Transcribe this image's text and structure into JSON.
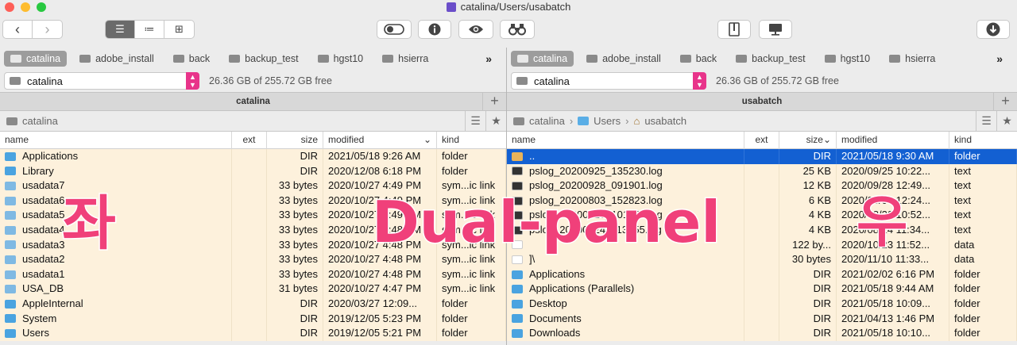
{
  "window": {
    "title": "catalina/Users/usabatch"
  },
  "toolbar": {
    "back": "‹",
    "forward": "›",
    "view_list": "☰",
    "view_detail": "≔",
    "view_grid": "⊞",
    "toggle_icon": "toggle-icon",
    "info_icon": "i",
    "eye_icon": "eye-icon",
    "binoculars_icon": "binoculars-icon",
    "archive_icon": "archive-icon",
    "network_icon": "network-icon",
    "download_icon": "↓"
  },
  "tabs": [
    "catalina",
    "adobe_install",
    "back",
    "backup_test",
    "hgst10",
    "hsierra"
  ],
  "tabs_more": "»",
  "left": {
    "volume": "catalina",
    "free": "26.36 GB of 255.72 GB free",
    "path_title": "catalina",
    "crumbs": [
      "catalina"
    ],
    "columns": {
      "name": "name",
      "ext": "ext",
      "size": "size",
      "modified": "modified",
      "kind": "kind"
    },
    "rows": [
      {
        "name": "Applications",
        "ext": "",
        "size": "DIR",
        "modified": "2021/05/18 9:26 AM",
        "kind": "folder",
        "icon": "folder"
      },
      {
        "name": "Library",
        "ext": "",
        "size": "DIR",
        "modified": "2020/12/08 6:18 PM",
        "kind": "folder",
        "icon": "folder"
      },
      {
        "name": "usadata7",
        "ext": "",
        "size": "33 bytes",
        "modified": "2020/10/27 4:49 PM",
        "kind": "sym...ic link",
        "icon": "link"
      },
      {
        "name": "usadata6",
        "ext": "",
        "size": "33 bytes",
        "modified": "2020/10/27 4:49 PM",
        "kind": "sym...ic link",
        "icon": "link"
      },
      {
        "name": "usadata5",
        "ext": "",
        "size": "33 bytes",
        "modified": "2020/10/27 4:49 PM",
        "kind": "sym...ic link",
        "icon": "link"
      },
      {
        "name": "usadata4",
        "ext": "",
        "size": "33 bytes",
        "modified": "2020/10/27 4:48 PM",
        "kind": "sym...ic link",
        "icon": "link"
      },
      {
        "name": "usadata3",
        "ext": "",
        "size": "33 bytes",
        "modified": "2020/10/27 4:48 PM",
        "kind": "sym...ic link",
        "icon": "link"
      },
      {
        "name": "usadata2",
        "ext": "",
        "size": "33 bytes",
        "modified": "2020/10/27 4:48 PM",
        "kind": "sym...ic link",
        "icon": "link"
      },
      {
        "name": "usadata1",
        "ext": "",
        "size": "33 bytes",
        "modified": "2020/10/27 4:48 PM",
        "kind": "sym...ic link",
        "icon": "link"
      },
      {
        "name": "USA_DB",
        "ext": "",
        "size": "31 bytes",
        "modified": "2020/10/27 4:47 PM",
        "kind": "sym...ic link",
        "icon": "link"
      },
      {
        "name": "AppleInternal",
        "ext": "",
        "size": "DIR",
        "modified": "2020/03/27 12:09...",
        "kind": "folder",
        "icon": "folder"
      },
      {
        "name": "System",
        "ext": "",
        "size": "DIR",
        "modified": "2019/12/05 5:23 PM",
        "kind": "folder",
        "icon": "folder"
      },
      {
        "name": "Users",
        "ext": "",
        "size": "DIR",
        "modified": "2019/12/05 5:21 PM",
        "kind": "folder",
        "icon": "folder"
      }
    ]
  },
  "right": {
    "volume": "catalina",
    "free": "26.36 GB of 255.72 GB free",
    "path_title": "usabatch",
    "crumbs": [
      "catalina",
      "Users",
      "usabatch"
    ],
    "columns": {
      "name": "name",
      "ext": "ext",
      "size": "size",
      "modified": "modified",
      "kind": "kind"
    },
    "rows": [
      {
        "name": "..",
        "ext": "",
        "size": "DIR",
        "modified": "2021/05/18 9:30 AM",
        "kind": "folder",
        "icon": "up",
        "selected": true
      },
      {
        "name": "pslog_20200925_135230.log",
        "ext": "",
        "size": "25 KB",
        "modified": "2020/09/25 10:22...",
        "kind": "text",
        "icon": "log"
      },
      {
        "name": "pslog_20200928_091901.log",
        "ext": "",
        "size": "12 KB",
        "modified": "2020/09/28 12:49...",
        "kind": "text",
        "icon": "log"
      },
      {
        "name": "pslog_20200803_152823.log",
        "ext": "",
        "size": "6 KB",
        "modified": "2020/08/03 12:24...",
        "kind": "text",
        "icon": "log"
      },
      {
        "name": "pslog_20200820_101652.log",
        "ext": "",
        "size": "4 KB",
        "modified": "2020/08/20 10:52...",
        "kind": "text",
        "icon": "log"
      },
      {
        "name": "pslog_20200824_113455.log",
        "ext": "",
        "size": "4 KB",
        "modified": "2020/08/24 11:34...",
        "kind": "text",
        "icon": "log"
      },
      {
        "name": "",
        "ext": "",
        "size": "122 by...",
        "modified": "2020/10/23 11:52...",
        "kind": "data",
        "icon": "file"
      },
      {
        "name": "]\\",
        "ext": "",
        "size": "30 bytes",
        "modified": "2020/11/10 11:33...",
        "kind": "data",
        "icon": "file"
      },
      {
        "name": "Applications",
        "ext": "",
        "size": "DIR",
        "modified": "2021/02/02 6:16 PM",
        "kind": "folder",
        "icon": "folder"
      },
      {
        "name": "Applications (Parallels)",
        "ext": "",
        "size": "DIR",
        "modified": "2021/05/18 9:44 AM",
        "kind": "folder",
        "icon": "folder"
      },
      {
        "name": "Desktop",
        "ext": "",
        "size": "DIR",
        "modified": "2021/05/18 10:09...",
        "kind": "folder",
        "icon": "folder"
      },
      {
        "name": "Documents",
        "ext": "",
        "size": "DIR",
        "modified": "2021/04/13 1:46 PM",
        "kind": "folder",
        "icon": "folder"
      },
      {
        "name": "Downloads",
        "ext": "",
        "size": "DIR",
        "modified": "2021/05/18 10:10...",
        "kind": "folder",
        "icon": "folder"
      }
    ]
  },
  "overlay": {
    "left": "좌",
    "center": "Dual-panel",
    "right": "우"
  },
  "colors": {
    "selection": "#1360d2",
    "row_bg": "#fdf1dc",
    "stepper": "#e8348a",
    "overlay": "#f0407a"
  }
}
